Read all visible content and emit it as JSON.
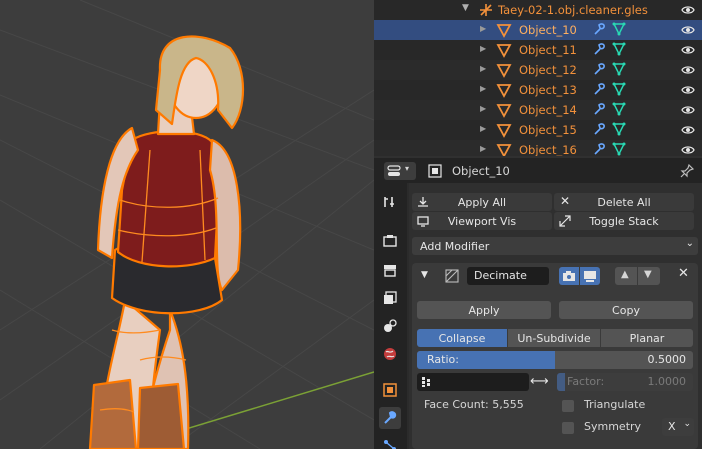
{
  "outliner": {
    "parent": {
      "name": "Taey-02-1.obj.cleaner.gles"
    },
    "children": [
      {
        "name": "Object_10",
        "selected": true
      },
      {
        "name": "Object_11",
        "selected": false
      },
      {
        "name": "Object_12",
        "selected": false
      },
      {
        "name": "Object_13",
        "selected": false
      },
      {
        "name": "Object_14",
        "selected": false
      },
      {
        "name": "Object_15",
        "selected": false
      },
      {
        "name": "Object_16",
        "selected": false
      }
    ]
  },
  "properties": {
    "object_name": "Object_10",
    "tabs": [
      "tool-icon",
      "render-icon",
      "output-icon",
      "view-layer-icon",
      "scene-icon",
      "world-icon",
      "object-icon",
      "modifier-icon",
      "particles-icon"
    ],
    "active_tab": "modifier-icon",
    "toolbar": {
      "apply_all": "Apply All",
      "delete_all": "Delete All",
      "viewport_vis": "Viewport Vis",
      "toggle_stack": "Toggle Stack"
    },
    "add_modifier": "Add Modifier",
    "modifier": {
      "name": "Decimate",
      "apply": "Apply",
      "copy": "Copy",
      "modes": [
        "Collapse",
        "Un-Subdivide",
        "Planar"
      ],
      "active_mode": "Collapse",
      "ratio_label": "Ratio:",
      "ratio_value": "0.5000",
      "ratio_fraction": 0.5,
      "factor_label": "Factor:",
      "factor_value": "1.0000",
      "face_count": "Face Count: 5,555",
      "triangulate": "Triangulate",
      "symmetry": "Symmetry",
      "symmetry_axis": "X"
    }
  },
  "colors": {
    "selection_outline": "#ff7a00",
    "outliner_text": "#f3913b",
    "selected_row": "#334d80",
    "active_button": "#4772b3",
    "wrench_icon": "#6aa8ff",
    "mesh_icon": "#29d9b4"
  }
}
